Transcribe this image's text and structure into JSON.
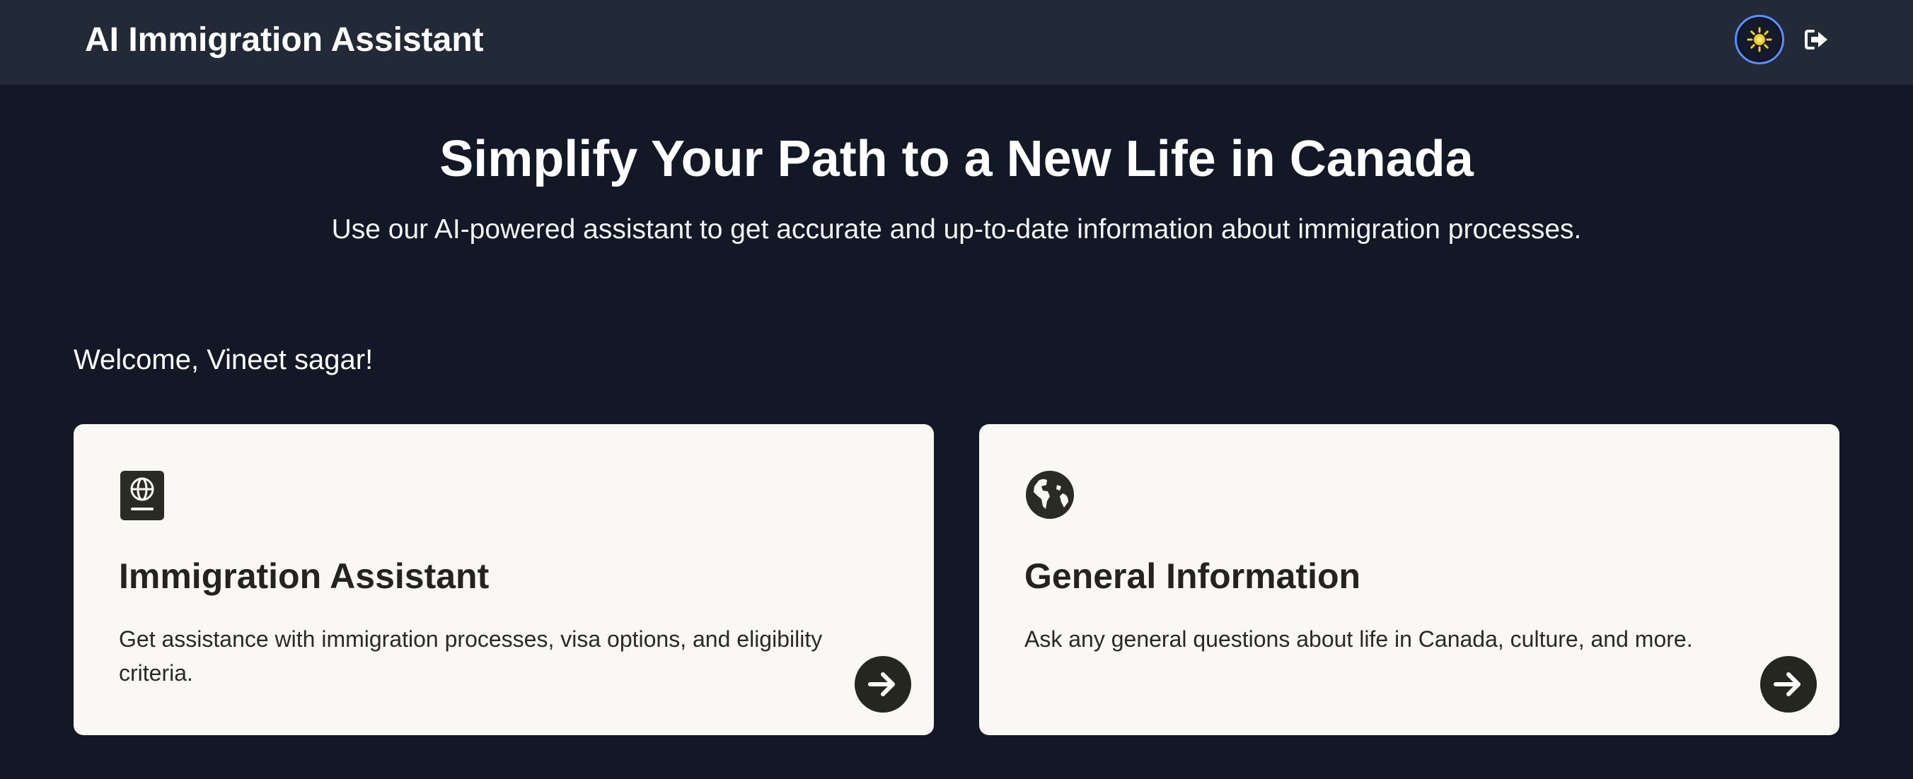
{
  "header": {
    "app_title": "AI Immigration Assistant",
    "theme_toggle_icon": "sun-icon",
    "logout_icon": "sign-out-icon"
  },
  "hero": {
    "title": "Simplify Your Path to a New Life in Canada",
    "subtitle": "Use our AI-powered assistant to get accurate and up-to-date information about immigration processes."
  },
  "welcome": {
    "text": "Welcome, Vineet sagar!"
  },
  "cards": [
    {
      "icon": "passport-icon",
      "title": "Immigration Assistant",
      "description": "Get assistance with immigration processes, visa options, and eligibility criteria.",
      "action_icon": "arrow-right-icon"
    },
    {
      "icon": "globe-icon",
      "title": "General Information",
      "description": "Ask any general questions about life in Canada, culture, and more.",
      "action_icon": "arrow-right-icon"
    }
  ],
  "colors": {
    "page_background": "#131827",
    "header_background": "#222937",
    "card_background": "#faf8f4",
    "card_text": "#24231f",
    "toggle_ring": "#5d8dff",
    "sun_icon": "#f5c928"
  }
}
